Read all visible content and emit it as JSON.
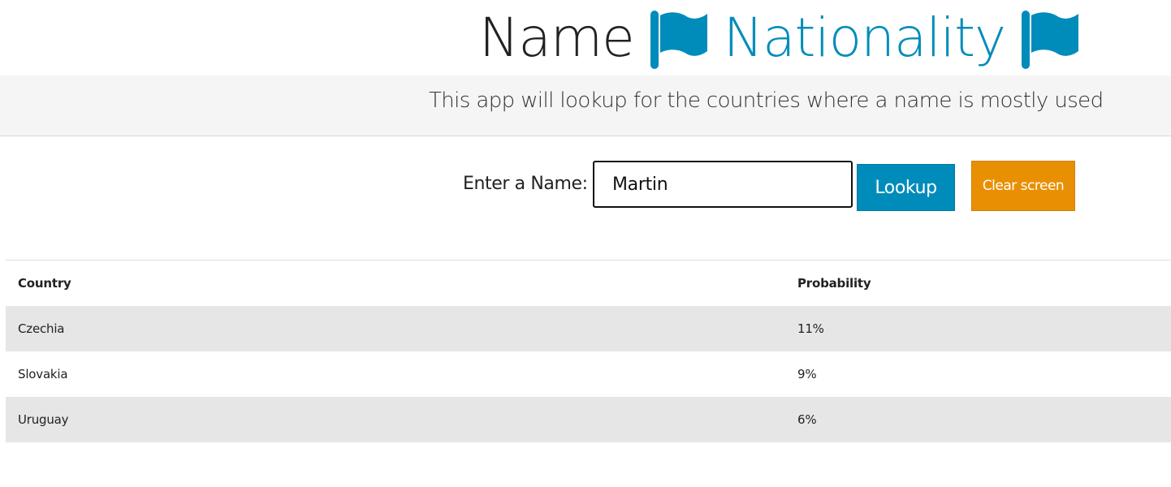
{
  "header": {
    "title_first": "Name",
    "title_second": "Nationality",
    "flag_icon": "flag-icon",
    "accent_color": "#008cba"
  },
  "band": {
    "subtitle": "This app will lookup for the countries where a name is mostly used"
  },
  "form": {
    "label": "Enter a Name:",
    "name_value": "Martin",
    "lookup_label": "Lookup",
    "clear_label": "Clear screen",
    "lookup_color": "#008cba",
    "clear_color": "#e99002"
  },
  "table": {
    "headers": [
      "Country",
      "Probability"
    ],
    "rows": [
      {
        "country": "Czechia",
        "probability": "11%"
      },
      {
        "country": "Slovakia",
        "probability": "9%"
      },
      {
        "country": "Uruguay",
        "probability": "6%"
      }
    ]
  }
}
